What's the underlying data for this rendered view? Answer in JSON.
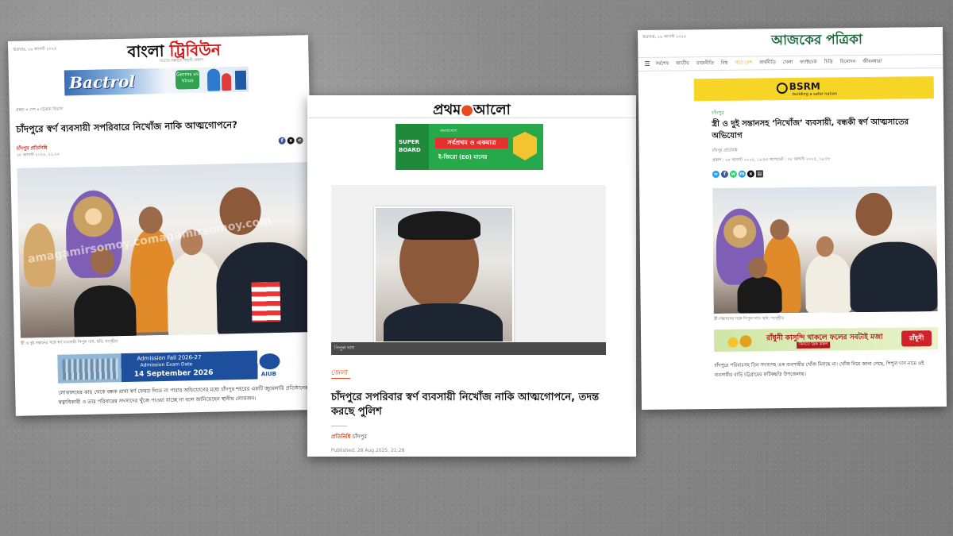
{
  "paper1": {
    "date": "শুক্রবার, ২৯ আগস্ট ২০২৫",
    "logo_main": "বাংলা",
    "logo_accent": "ট্রিবিউন",
    "tagline": "সত্যের সন্ধানে সাহসী প্রকাশ",
    "ad_brand": "Bactrol",
    "ad_germs": "Germs vs Virus",
    "crumb": "প্রচ্ছদ » দেশ » চট্টগ্রাম বিভাগ",
    "headline": "চাঁদপুরে স্বর্ণ ব্যবসায়ী সপরিবারে নিখোঁজ নাকি আত্মগোপনে?",
    "author": "চাঁদপুর প্রতিনিধি",
    "published": "২৮ আগস্ট ২০২৫, ২১:২৫",
    "photo_caption": "স্ত্রী ও দুই সন্তানের সঙ্গে স্বর্ণ ব্যবসায়ী পিপুল দাস, ছবি: সংগৃহীত",
    "watermark": "amagamirsomoy.comagamirsomoy.com",
    "ad_line1": "Admission Fall 2026-27",
    "ad_line2": "Admission Exam Date",
    "ad_line3": "14 September 2026",
    "ad_logo": "AIUB",
    "body": "লোকালয়ের কাছ থেকে বন্ধক রাখা স্বর্ণ ফেরত দিতে না পারার অভিযোগের মধ্যে চাঁদপুর শহরের একটি জুয়েলারি প্রতিষ্ঠানের স্বত্বাধিকারী ও তার পরিবারের সদস্যদের খুঁজে পাওয়া যাচ্ছে না বলে জানিয়েছেন স্থানীয় লোকজন।"
  },
  "paper2": {
    "logo_a": "প্রথম",
    "logo_b": "আলো",
    "ad_sb": "SUPER BOARD",
    "ad_m1": "বাংলাদেশে",
    "ad_m2": "সর্বপ্রথম ও একমাত্র",
    "ad_m3": "ই-জিরো (E0) মানের",
    "photo_caption": "পিপুল দাস",
    "section": "জেলা",
    "headline": "চাঁদপুরে সপরিবার স্বর্ণ ব্যবসায়ী নিখোঁজ নাকি আত্মগোপনে, তদন্ত করছে পুলিশ",
    "author_label": "প্রতিনিধি",
    "author_place": "চাঁদপুর",
    "published": "Published: 28 Aug 2025, 21:28"
  },
  "paper3": {
    "date": "শুক্রবার, ২৯ আগস্ট ২০২৫",
    "logo": "আজকের পত্রিকা",
    "nav": [
      "সর্বশেষ",
      "জাতীয়",
      "রাজনীতি",
      "বিশ্ব",
      "সারা দেশ",
      "অর্থনীতি",
      "খেলা",
      "ফ্যাক্টচেক",
      "চিত্তি",
      "বিনোদন",
      "জীবনধারা"
    ],
    "nav_highlight": "সারা দেশ",
    "ad_brand": "BSRM",
    "ad_slogan": "building a safer nation",
    "section": "চাঁদপুর",
    "headline": "স্ত্রী ও দুই সন্তানসহ ‘নিখোঁজ’ ব্যবসায়ী, বন্ধকী স্বর্ণ আত্মসাতের অভিযোগ",
    "author": "চাঁদপুর প্রতিনিধি",
    "pubinfo": "প্রকাশ : ২৮ আগস্ট ২০২৫, ১৯:৪৫   আপডেট : ২৮ আগস্ট ২০২৫, ১৯:৫৮",
    "photo_caption": "স্ত্রী-সন্তানদের সঙ্গে পিপুল দাস। ছবি: সংগৃহীত",
    "ad_text": "রাঁধুনী কাসুন্দি থাকলে ফলের সবটাই মজা",
    "ad_btn": "কিনতে ক্লিক করুন",
    "ad_logo": "রাঁধুনী",
    "body": "চাঁদপুরে পরিবারসহ তিন সদস্যসহ এক ব্যবসায়ীর খোঁজ মিলছে না। খোঁজ নিয়ে জানা গেছে, পিপুল দাস নামে ওই ব্যবসায়ীর বাড়ি চট্টগ্রামের ফটিকছড়ি উপজেলায়।"
  }
}
